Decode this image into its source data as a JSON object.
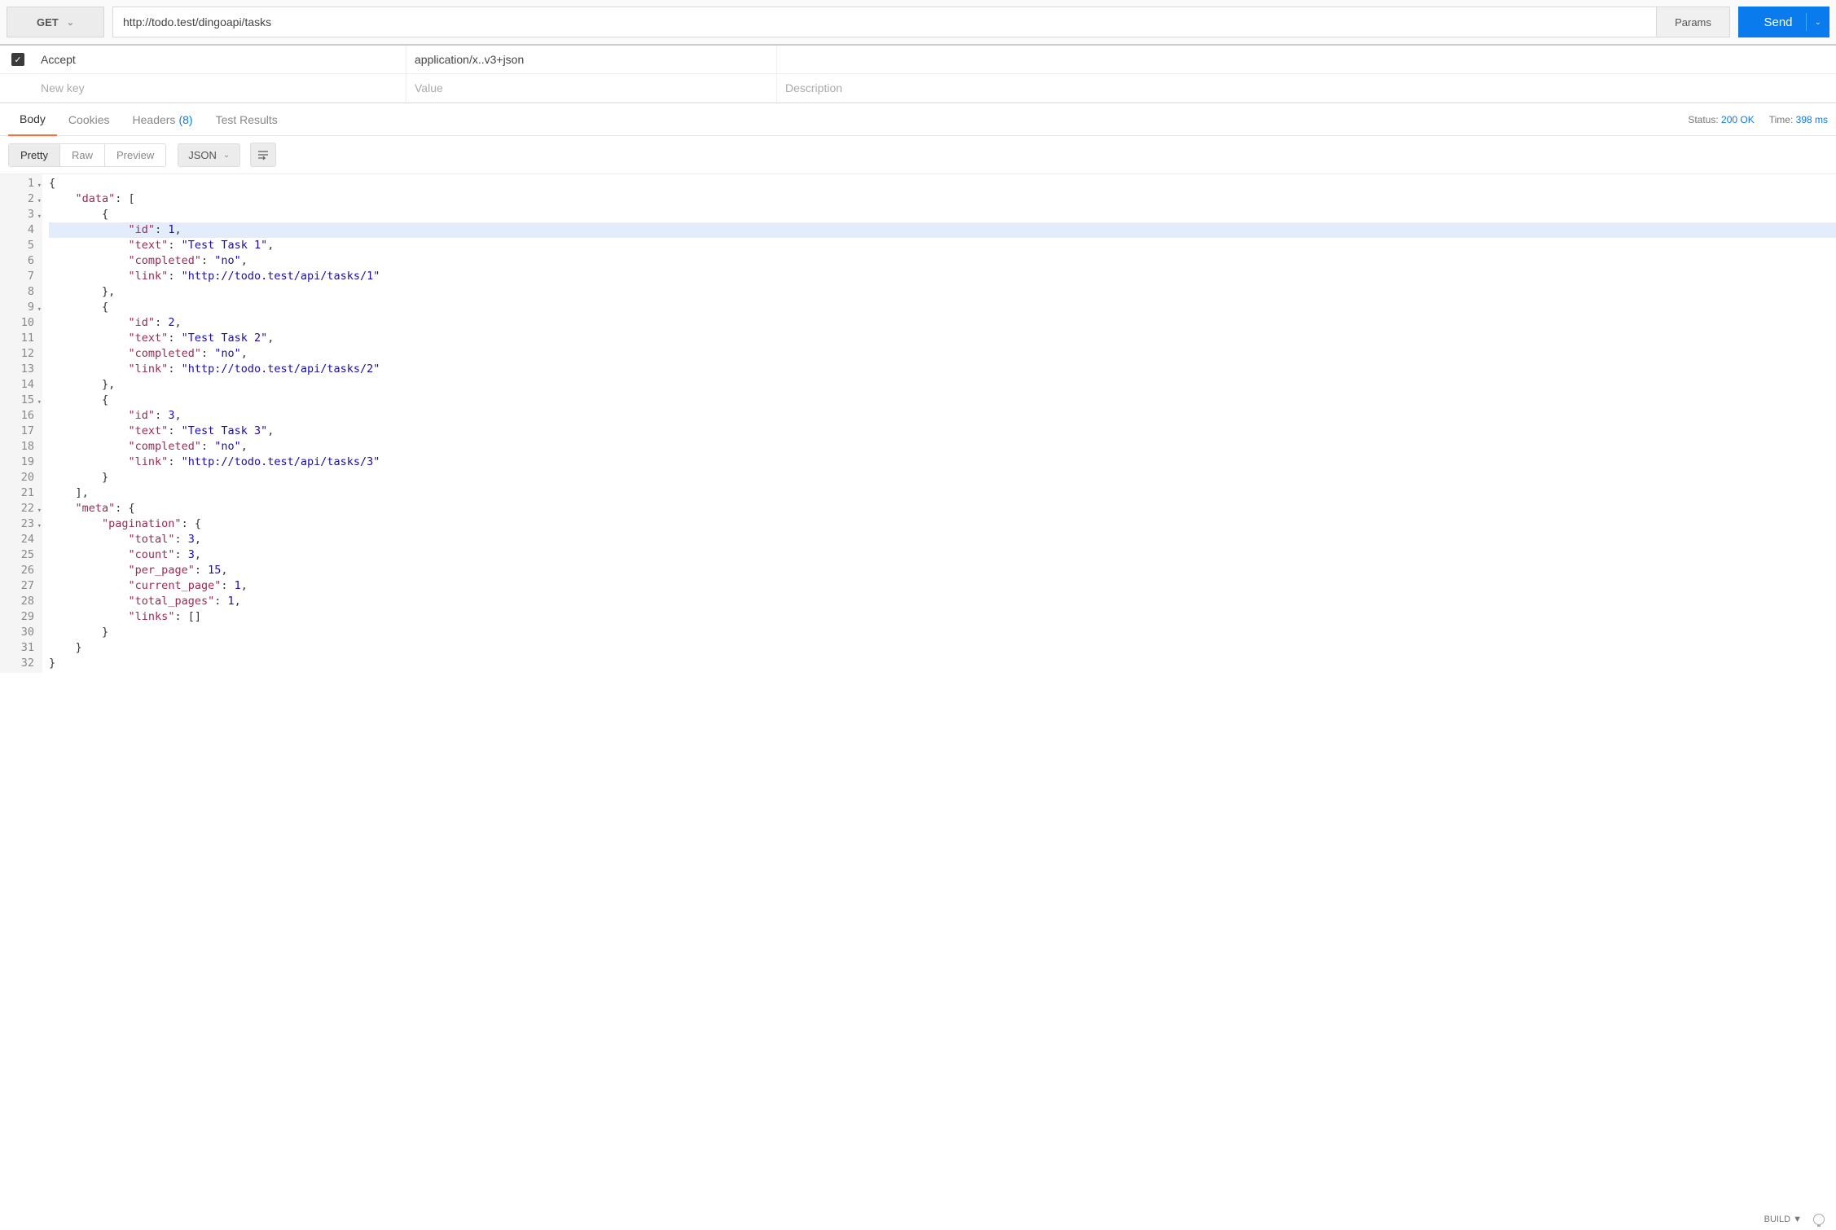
{
  "request": {
    "method": "GET",
    "url": "http://todo.test/dingoapi/tasks",
    "params_label": "Params",
    "send_label": "Send"
  },
  "headers": {
    "rows": [
      {
        "enabled": true,
        "key": "Accept",
        "value": "application/x..v3+json",
        "description": ""
      }
    ],
    "placeholders": {
      "key": "New key",
      "value": "Value",
      "description": "Description"
    }
  },
  "response_tabs": {
    "body": "Body",
    "cookies": "Cookies",
    "headers": "Headers",
    "headers_count": "(8)",
    "test_results": "Test Results"
  },
  "response_meta": {
    "status_label": "Status:",
    "status_value": "200 OK",
    "time_label": "Time:",
    "time_value": "398 ms"
  },
  "view": {
    "pretty": "Pretty",
    "raw": "Raw",
    "preview": "Preview",
    "format": "JSON"
  },
  "code_lines": [
    {
      "n": 1,
      "fold": true,
      "indent": 0,
      "kind": "punct",
      "text": "{"
    },
    {
      "n": 2,
      "fold": true,
      "indent": 1,
      "kind": "kv_open",
      "key": "data",
      "open": "["
    },
    {
      "n": 3,
      "fold": true,
      "indent": 2,
      "kind": "punct",
      "text": "{"
    },
    {
      "n": 4,
      "hl": true,
      "indent": 3,
      "kind": "kv_num",
      "key": "id",
      "val": "1",
      "comma": true
    },
    {
      "n": 5,
      "indent": 3,
      "kind": "kv_str",
      "key": "text",
      "val": "Test Task 1",
      "comma": true
    },
    {
      "n": 6,
      "indent": 3,
      "kind": "kv_str",
      "key": "completed",
      "val": "no",
      "comma": true
    },
    {
      "n": 7,
      "indent": 3,
      "kind": "kv_str",
      "key": "link",
      "val": "http://todo.test/api/tasks/1"
    },
    {
      "n": 8,
      "indent": 2,
      "kind": "punct",
      "text": "},"
    },
    {
      "n": 9,
      "fold": true,
      "indent": 2,
      "kind": "punct",
      "text": "{"
    },
    {
      "n": 10,
      "indent": 3,
      "kind": "kv_num",
      "key": "id",
      "val": "2",
      "comma": true
    },
    {
      "n": 11,
      "indent": 3,
      "kind": "kv_str",
      "key": "text",
      "val": "Test Task 2",
      "comma": true
    },
    {
      "n": 12,
      "indent": 3,
      "kind": "kv_str",
      "key": "completed",
      "val": "no",
      "comma": true
    },
    {
      "n": 13,
      "indent": 3,
      "kind": "kv_str",
      "key": "link",
      "val": "http://todo.test/api/tasks/2"
    },
    {
      "n": 14,
      "indent": 2,
      "kind": "punct",
      "text": "},"
    },
    {
      "n": 15,
      "fold": true,
      "indent": 2,
      "kind": "punct",
      "text": "{"
    },
    {
      "n": 16,
      "indent": 3,
      "kind": "kv_num",
      "key": "id",
      "val": "3",
      "comma": true
    },
    {
      "n": 17,
      "indent": 3,
      "kind": "kv_str",
      "key": "text",
      "val": "Test Task 3",
      "comma": true
    },
    {
      "n": 18,
      "indent": 3,
      "kind": "kv_str",
      "key": "completed",
      "val": "no",
      "comma": true
    },
    {
      "n": 19,
      "indent": 3,
      "kind": "kv_str",
      "key": "link",
      "val": "http://todo.test/api/tasks/3"
    },
    {
      "n": 20,
      "indent": 2,
      "kind": "punct",
      "text": "}"
    },
    {
      "n": 21,
      "indent": 1,
      "kind": "punct",
      "text": "],"
    },
    {
      "n": 22,
      "fold": true,
      "indent": 1,
      "kind": "kv_open",
      "key": "meta",
      "open": "{"
    },
    {
      "n": 23,
      "fold": true,
      "indent": 2,
      "kind": "kv_open",
      "key": "pagination",
      "open": "{"
    },
    {
      "n": 24,
      "indent": 3,
      "kind": "kv_num",
      "key": "total",
      "val": "3",
      "comma": true
    },
    {
      "n": 25,
      "indent": 3,
      "kind": "kv_num",
      "key": "count",
      "val": "3",
      "comma": true
    },
    {
      "n": 26,
      "indent": 3,
      "kind": "kv_num",
      "key": "per_page",
      "val": "15",
      "comma": true
    },
    {
      "n": 27,
      "indent": 3,
      "kind": "kv_num",
      "key": "current_page",
      "val": "1",
      "comma": true
    },
    {
      "n": 28,
      "indent": 3,
      "kind": "kv_num",
      "key": "total_pages",
      "val": "1",
      "comma": true
    },
    {
      "n": 29,
      "indent": 3,
      "kind": "kv_raw",
      "key": "links",
      "raw": "[]"
    },
    {
      "n": 30,
      "indent": 2,
      "kind": "punct",
      "text": "}"
    },
    {
      "n": 31,
      "indent": 1,
      "kind": "punct",
      "text": "}"
    },
    {
      "n": 32,
      "indent": 0,
      "kind": "punct",
      "text": "}"
    }
  ],
  "footer": {
    "build": "BUILD ▼"
  }
}
